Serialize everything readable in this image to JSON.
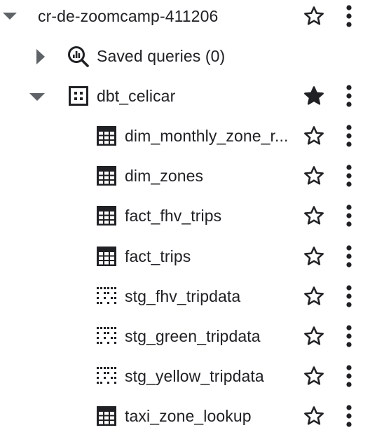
{
  "project": {
    "name": "cr-de-zoomcamp-411206"
  },
  "saved_queries": {
    "label": "Saved queries (0)"
  },
  "dataset": {
    "name": "dbt_celicar",
    "starred": true
  },
  "tables": [
    {
      "name": "dim_monthly_zone_r...",
      "kind": "table"
    },
    {
      "name": "dim_zones",
      "kind": "table"
    },
    {
      "name": "fact_fhv_trips",
      "kind": "table"
    },
    {
      "name": "fact_trips",
      "kind": "table"
    },
    {
      "name": "stg_fhv_tripdata",
      "kind": "view"
    },
    {
      "name": "stg_green_tripdata",
      "kind": "view"
    },
    {
      "name": "stg_yellow_tripdata",
      "kind": "view"
    },
    {
      "name": "taxi_zone_lookup",
      "kind": "table"
    }
  ],
  "colors": {
    "text": "#202124",
    "icon": "#202124",
    "caret": "#5f6368"
  },
  "icons": {
    "collapse": "caret-down-icon",
    "expand": "caret-right-icon",
    "saved_queries": "query-search-icon",
    "dataset": "dataset-grid-icon",
    "table": "table-icon",
    "view": "view-dotted-icon",
    "star_empty": "star-outline-icon",
    "star_filled": "star-filled-icon",
    "more": "more-vertical-icon"
  }
}
